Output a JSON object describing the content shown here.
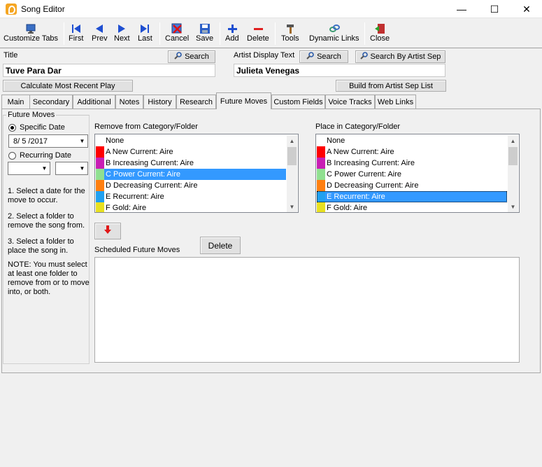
{
  "window": {
    "title": "Song Editor",
    "minimize": "—",
    "maximize": "☐",
    "close": "✕"
  },
  "toolbar": {
    "customize_tabs": "Customize Tabs",
    "first": "First",
    "prev": "Prev",
    "next": "Next",
    "last": "Last",
    "cancel": "Cancel",
    "save": "Save",
    "add": "Add",
    "delete": "Delete",
    "tools": "Tools",
    "dynamic_links": "Dynamic Links",
    "close": "Close"
  },
  "fields": {
    "title_label": "Title",
    "title_value": "Tuve Para Dar",
    "title_search": "Search",
    "artist_label": "Artist Display Text",
    "artist_value": "Julieta Venegas",
    "artist_search": "Search",
    "search_by_artist_sep": "Search By Artist Sep",
    "calc_recent": "Calculate Most Recent Play",
    "build_artist_sep": "Build from Artist Sep List"
  },
  "tabs": [
    "Main",
    "Secondary",
    "Additional",
    "Notes",
    "History",
    "Research",
    "Future Moves",
    "Custom Fields",
    "Voice Tracks",
    "Web Links"
  ],
  "active_tab": "Future Moves",
  "future_moves": {
    "group_label": "Future Moves",
    "specific_date_label": "Specific Date",
    "specific_date_value": "8/ 5 /2017",
    "recurring_date_label": "Recurring Date",
    "help_1": "1. Select a date for the move to occur.",
    "help_2": "2. Select a folder to remove the song from.",
    "help_3": "3. Select a folder to place the song in.",
    "help_note": "NOTE: You must select at least one folder to remove from or to move into, or both.",
    "remove_label": "Remove from Category/Folder",
    "place_label": "Place in Category/Folder",
    "scheduled_label": "Scheduled Future Moves",
    "delete_button": "Delete",
    "remove_list": [
      {
        "label": "None",
        "color": ""
      },
      {
        "label": "A New Current: Aire",
        "color": "#ff0000"
      },
      {
        "label": "B Increasing Current: Aire",
        "color": "#c81eb4"
      },
      {
        "label": "C Power Current: Aire",
        "color": "#90e090"
      },
      {
        "label": "D Decreasing Current: Aire",
        "color": "#ff7f10"
      },
      {
        "label": "E Recurrent: Aire",
        "color": "#20a0f0"
      },
      {
        "label": "F Gold: Aire",
        "color": "#e8e020"
      }
    ],
    "remove_selected": "C Power Current: Aire",
    "place_list": [
      {
        "label": "None",
        "color": ""
      },
      {
        "label": "A New Current: Aire",
        "color": "#ff0000"
      },
      {
        "label": "B Increasing Current: Aire",
        "color": "#c81eb4"
      },
      {
        "label": "C Power Current: Aire",
        "color": "#90e090"
      },
      {
        "label": "D Decreasing Current: Aire",
        "color": "#ff7f10"
      },
      {
        "label": "E Recurrent: Aire",
        "color": "#20a0f0"
      },
      {
        "label": "F Gold: Aire",
        "color": "#e8e020"
      }
    ],
    "place_selected": "E Recurrent: Aire"
  }
}
